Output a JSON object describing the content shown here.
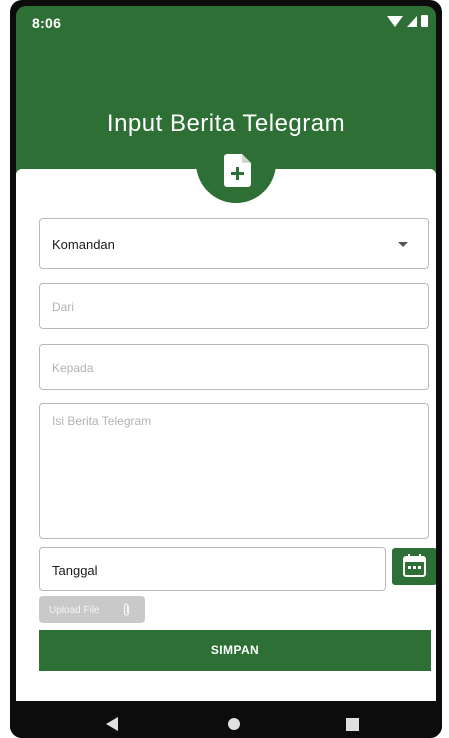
{
  "status_bar": {
    "time": "8:06",
    "icons": [
      "wifi-icon",
      "signal-icon",
      "battery-icon"
    ]
  },
  "header": {
    "title": "Input Berita Telegram",
    "icon": "document-add-icon"
  },
  "form": {
    "komandan_dropdown": {
      "selected": "Komandan"
    },
    "dari_field": {
      "placeholder": "Dari",
      "value": ""
    },
    "kepada_field": {
      "placeholder": "Kepada",
      "value": ""
    },
    "isi_field": {
      "placeholder": "Isi Berita Telegram",
      "value": ""
    },
    "tanggal_field": {
      "value": "Tanggal"
    },
    "calendar_icon": "calendar-icon",
    "upload_button": {
      "label": "Upload File",
      "icon": "paperclip-icon"
    },
    "save_button": {
      "label": "SIMPAN"
    }
  },
  "nav_bar": {
    "buttons": [
      "back-icon",
      "home-icon",
      "recent-apps-icon"
    ]
  },
  "colors": {
    "primary": "#2e6f35",
    "background": "#ffffff",
    "border": "#b9b9b9",
    "placeholder": "#b3b3b3",
    "upload_disabled": "#c9c9c9"
  }
}
